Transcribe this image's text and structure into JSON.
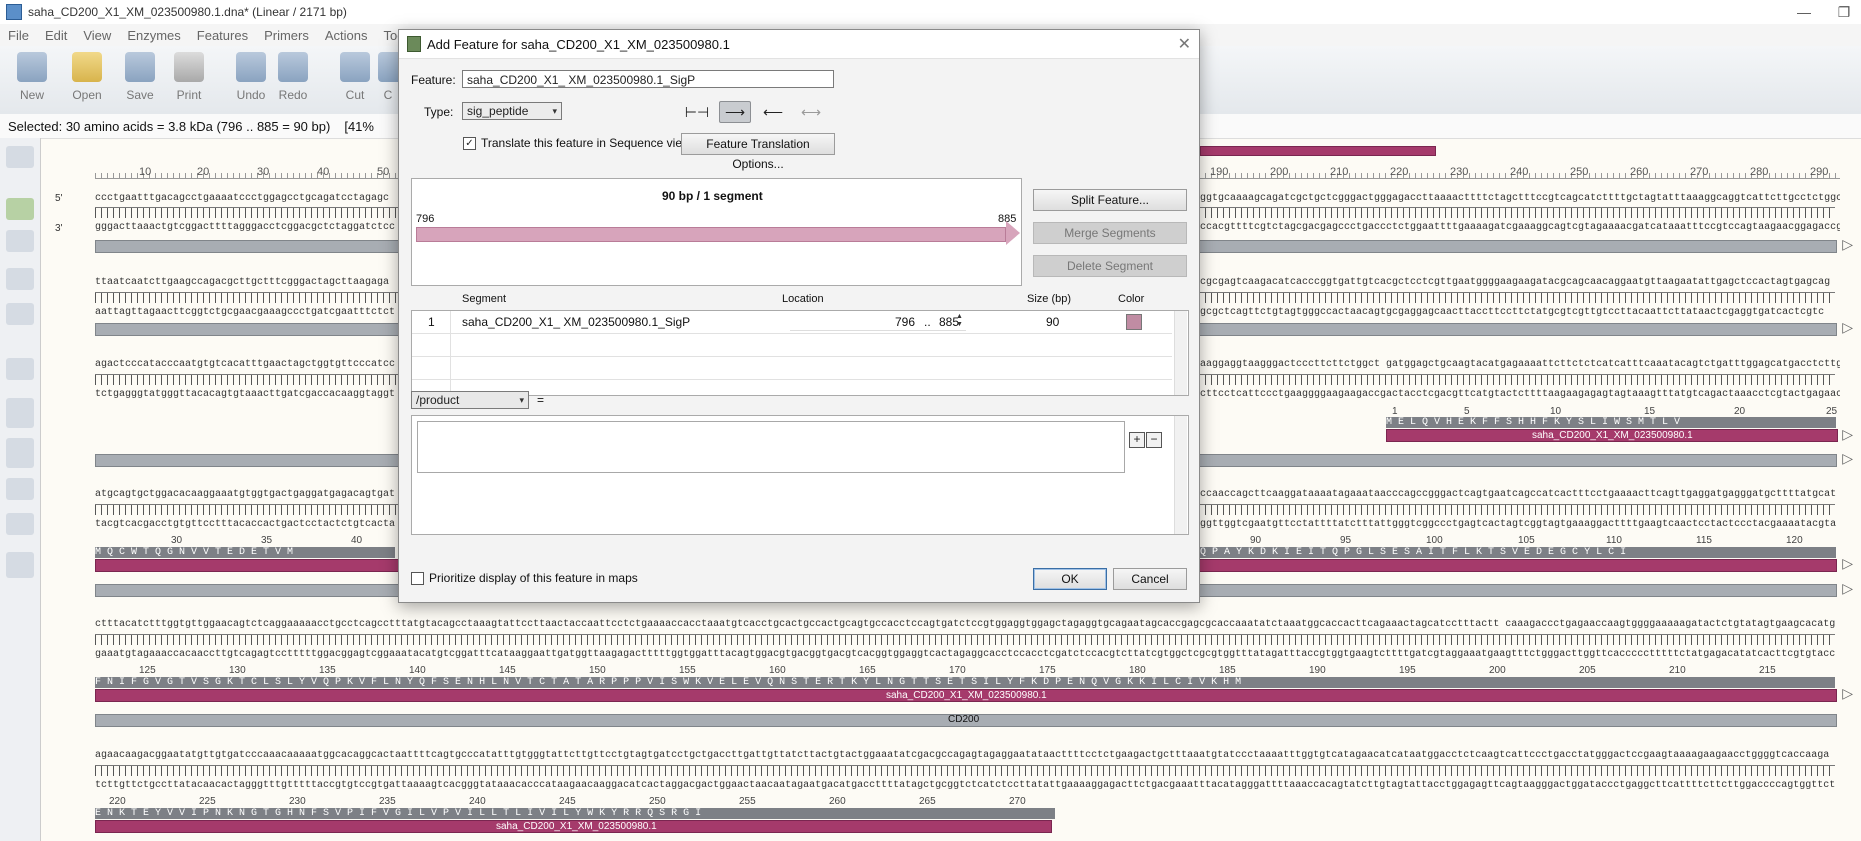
{
  "window": {
    "title": "saha_CD200_X1_XM_023500980.1.dna* (Linear / 2171 bp)"
  },
  "menu": [
    "File",
    "Edit",
    "View",
    "Enzymes",
    "Features",
    "Primers",
    "Actions",
    "Tools"
  ],
  "toolbar": {
    "new": "New",
    "open": "Open",
    "save": "Save",
    "print": "Print",
    "undo": "Undo",
    "redo": "Redo",
    "cut": "Cut",
    "copy": "C"
  },
  "selection": {
    "text": "Selected:  30 amino acids  =  3.8 kDa  (796 .. 885  =  90 bp)",
    "pct": "[41%"
  },
  "sequence": {
    "strand5": "5'",
    "strand3": "3'",
    "ruler": [
      "10",
      "20",
      "30",
      "40",
      "50",
      "190",
      "200",
      "210",
      "220",
      "230",
      "240",
      "250",
      "260",
      "270",
      "280",
      "290"
    ],
    "rows": [
      {
        "top": "ccctgaatttgacagcctgaaaatccctggagcctgcagatcctagagc",
        "top_right": "ggtgcaaaagcagatcgctgctcgggactgggagaccttaaaacttttctagctttccgtcagcatcttttgctagtatttaaaggcaggtcattcttgcctctggc",
        "bot": "gggacttaaactgtcggacttttagggacctcggacgctctaggatctcc",
        "bot_right": "ccacgttttcgtctagcgacgagccctgaccctctggaattttgaaaagatcgaaaggcagtcgtagaaaacgatcataaatttccgtccagtaagaacggagaccg"
      },
      {
        "top": "ttaatcaatcttgaagccagacgcttgctttcgggactagcttaagaga",
        "top_right": "cgcgagtcaagacatcacccggtgattgtcacgctcctcgttgaatggggaagaagatacgcagcaacaggaatgttaagaatattgagctccactagtgagcag",
        "bot": "aattagttagaacttcggtctgcgaacgaaagccctgatcgaatttctct",
        "bot_right": "gcgctcagttctgtagtgggccactaacagtgcgaggagcaacttaccttccttctatgcgtcgttgtccttacaattcttataactcgaggtgatcactcgtc"
      },
      {
        "top": "agactcccatacccaatgtgtcacatttgaactagctggtgttcccatcccc",
        "top_right": "aaggaggtaagggactcccttcttctggct gatggagctgcaagtacatgagaaaattcttctctcatcatttcaaatacagtctgatttggagcatgacctcttgtg",
        "bot": "tctgagggtatgggttacacagtgtaaacttgatcgaccacaaggtaggtag",
        "bot_right": "cttcctcattccctgaaggggaagaagaccgactacctcgacgttcatgtactcttttaagaagagagtagtaaagtttatgtcagactaaacctcgtactgagaacac"
      },
      {
        "top": "atgcagtgctggacacaaggaaatgtggtgactgaggatgagacagtgata",
        "top_right": "ccaaccagcttcaaggataaaatagaaataacccagccgggactcagtgaatcagccatcactttcctgaaaacttcagttgaggatgagggatgcttttatgcat",
        "bot": "tacgtcacgacctgtgttcctttacaccactgactcctactctgtcactat",
        "bot_right": "ggttggtcgaatgttcctattttatctttattgggtcggccctgagtcactagtcggtagtgaaaggacttttgaagtcaactcctactccctacgaaaatacgta"
      },
      {
        "top": "ctttacatctttggtgttggaacagtctcaggaaaaacctgcctcagcctttatgtacagcctaaagtattccttaactaccaattcctctgaaaaccacctaaatgtcacctgcactgccactgcagtgccacctccagtgatctccgtggaggtggagctagaggtgcagaatagcaccgagcgcaccaaatatctaaatggcaccacttcagaaactagcatcctttactt caaagaccctgagaaccaagtggggaaaaagatactctgtatagtgaagcacatgg",
        "bot": "gaaatgtagaaaccacaaccttgtcagagtcctttttggacggagtcggaaatacatgtcggatttcataaggaattgatggttaagagactttttggtggatttacagtggacgtgacggtgacgtcacggtggaggtcactagaggcacctccacctcgatctccacgtcttatcgtggctcgcgtggtttatagatttaccgtggtgaagtcttttgatcgtaggaaatgaagtttctgggacttggttcaccccctttttctatgagacatatcacttcgtgtacc"
      },
      {
        "top": "agaacaagacggaatatgttgtgatcccaaacaaaaatggcacaggcactaattttcagtgcccatatttgtgggtattcttgttcctgtagtgatcctgctgaccttgattgttatcttactgtactggaaatatcgacgccagagtagaggaatataacttttcctctgaagactgctttaaatgtatccctaaaatttggtgtcatagaacatcataatggacctctcaagtcattccctgacctatgggactccgaagtaaaagaagaacctggggtcaccaaga",
        "bot": "tcttgttctgccttatacaacactagggtttgtttttaccgtgtccgtgattaaaagtcacgggtataaacacccataagaacaaggacatcactaggacgactggaactaacaatagaatgacatgaccttttatagctgcggtctcatctccttatattgaaaaggagacttctgacgaaatttacatagggattttaaaccacagtatcttgtagtattacctggagagttcagtaagggactggataccctgaggcttcattttcttcttggaccccagtggttct"
      }
    ],
    "aa_row4_left": "M   Q   C   W   T   Q   G   N   V   V   T   E   D   E   T   V   M",
    "aa_row4_right": "Q   P   A   Y   K   D   K   I   E   I   T   Q   P   G   L   S   E   S   A   I   T   F   L   K   T   S   V   E   D   E   G   C   Y   L   C   I",
    "aa_row3_right": "M   E   L   Q   V   H   E   K   F   F   S   H   H   F   K   Y   S   L   I   W   S   M   T   L   V",
    "aa_row5": "F   N   I   F   G   V   G   T   V   S   G   K   T   C   L   S   L   Y   V   Q   P   K   V   F   L   N   Y   Q   F   S   E   N   H   L   N   V   T   C   T   A   T   A   R   P   P   P   V   I   S   W   K   V   E   L   E   V   Q   N   S   T   E   R   T   K   Y   L   N   G   T   T   S   E   T   S   I   L   Y   F   K   D   P   E   N   Q   V   G   K   K   I   L   C   I   V   K   H   M",
    "aa_row6": "E   N   K   T   E   Y   V   V   I   P   N   K   N   G   T   G   H   N   F   S   V   P   I   F   V   G   I   L   V   P   V   I   L   L   T   L   I   V   I   L   Y   W   K   Y   R   R   Q   S   R   G   I",
    "aa_nums_row3": [
      "1",
      "5",
      "10",
      "15",
      "20",
      "25"
    ],
    "aa_nums_row4_left": [
      "30",
      "35",
      "40"
    ],
    "aa_nums_row4_right": [
      "90",
      "95",
      "100",
      "105",
      "110",
      "115",
      "120"
    ],
    "aa_nums_row5": [
      "125",
      "130",
      "135",
      "140",
      "145",
      "150",
      "155",
      "160",
      "165",
      "170",
      "175",
      "180",
      "185",
      "190",
      "195",
      "200",
      "205",
      "210",
      "215"
    ],
    "aa_nums_row6": [
      "220",
      "225",
      "230",
      "235",
      "240",
      "245",
      "250",
      "255",
      "260",
      "265",
      "270"
    ],
    "feature_name": "saha_CD200_X1_XM_023500980.1",
    "gene_name": "CD200"
  },
  "dialog": {
    "title": "Add Feature for saha_CD200_X1_XM_023500980.1",
    "feature_label": "Feature:",
    "feature_value": "saha_CD200_X1_ XM_023500980.1_SigP",
    "type_label": "Type:",
    "type_value": "sig_peptide",
    "translate_label": "Translate this feature in Sequence view",
    "translation_options": "Feature Translation Options...",
    "map_header": "90 bp  /  1 segment",
    "map_start": "796",
    "map_end": "885",
    "split": "Split Feature...",
    "merge": "Merge Segments",
    "delete_seg": "Delete Segment",
    "col_segment": "Segment",
    "col_location": "Location",
    "col_size": "Size (bp)",
    "col_color": "Color",
    "segments": [
      {
        "index": "1",
        "name": "saha_CD200_X1_ XM_023500980.1_SigP",
        "start": "796",
        "sep": "..",
        "end": "885",
        "size": "90"
      }
    ],
    "qualifier": "/product",
    "qualifier_eq": "=",
    "prioritize_label": "Prioritize display of this feature in maps",
    "ok": "OK",
    "cancel": "Cancel",
    "colors": {
      "segment": "#c08ca3",
      "map_arrow": "#d7a4bb"
    }
  },
  "colors": {
    "feature_bar": "#a53a6b",
    "gene_bar": "#a8adb3",
    "aa_bar": "#7d8086"
  }
}
